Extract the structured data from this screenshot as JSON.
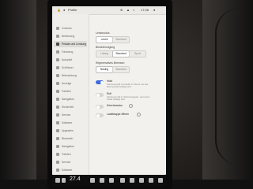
{
  "status_bar": {
    "profile": "Profile",
    "time": "17:08"
  },
  "sidebar": {
    "items": [
      {
        "label": "Controls",
        "icon": "toggle-icon"
      },
      {
        "label": "Bedienung",
        "icon": "car-icon"
      },
      {
        "label": "Pedale und Lenkung",
        "icon": "steering-icon",
        "active": true
      },
      {
        "label": "Fahrzeug",
        "icon": "car-icon"
      },
      {
        "label": "Autopilot",
        "icon": "wheel-icon"
      },
      {
        "label": "Schlösser",
        "icon": "lock-icon"
      },
      {
        "label": "Beleuchtung",
        "icon": "bulb-icon"
      },
      {
        "label": "Anzeige",
        "icon": "display-icon"
      },
      {
        "label": "Fahrten",
        "icon": "trip-icon"
      },
      {
        "label": "Navigation",
        "icon": "nav-icon"
      },
      {
        "label": "Sicherheit",
        "icon": "shield-icon"
      },
      {
        "label": "Service",
        "icon": "wrench-icon"
      },
      {
        "label": "Software",
        "icon": "download-icon"
      },
      {
        "label": "Upgrades",
        "icon": "bag-icon"
      },
      {
        "label": "Bluetooth",
        "icon": "bluetooth-icon"
      },
      {
        "label": "Navigation",
        "icon": "nav-icon"
      },
      {
        "label": "Fahrten",
        "icon": "trip-icon"
      },
      {
        "label": "Service",
        "icon": "wrench-icon"
      },
      {
        "label": "Software",
        "icon": "download-icon"
      }
    ]
  },
  "main": {
    "section1": {
      "title": "Lenkmodus",
      "options": [
        "Leicht",
        "Standard"
      ]
    },
    "section2": {
      "title": "Beschleunigung",
      "options": [
        "Lässig",
        "Standard",
        "Sport"
      ]
    },
    "section3": {
      "title": "Regeneratives Bremsen",
      "options": [
        "Niedrig",
        "Standard"
      ]
    },
    "settings": [
      {
        "label": "Hold",
        "desc": "Fahrzeug hält und bleibt im Stand, bis das Bremspedal betätigt wird",
        "on": true
      },
      {
        "label": "Roll",
        "desc": "Fahrzeug rollt im Stand langsam, wenn kein Pedal betätigt wird",
        "on": false
      },
      {
        "label": "Kriechmodus",
        "desc": "",
        "on": false
      },
      {
        "label": "Ladeklappe öffnen",
        "desc": "",
        "on": false
      }
    ]
  },
  "dock": {
    "temperature": "27.4"
  },
  "colors": {
    "accent": "#3e6ae1",
    "screen_bg": "#f2f1ee"
  }
}
